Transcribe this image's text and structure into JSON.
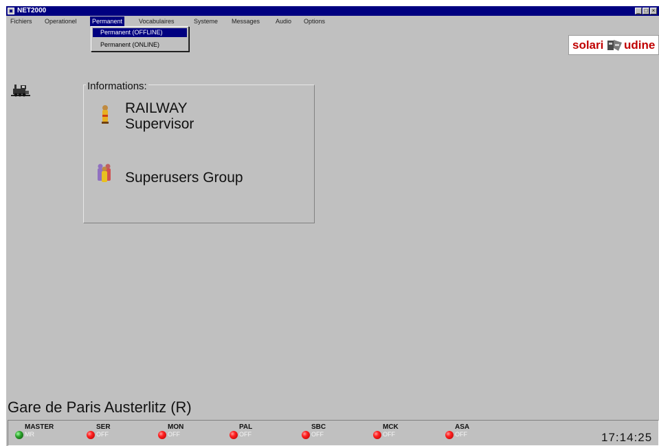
{
  "window": {
    "title": "NET2000"
  },
  "menubar": {
    "items": [
      {
        "label": "Fichiers"
      },
      {
        "label": "Operationel"
      },
      {
        "label": "Permanent"
      },
      {
        "label": "Vocabulaires"
      },
      {
        "label": "Systeme"
      },
      {
        "label": "Messages"
      },
      {
        "label": "Audio"
      },
      {
        "label": "Options"
      }
    ],
    "open_menu": {
      "items": [
        {
          "label": "Permanent (OFFLINE)",
          "selected": true
        },
        {
          "label": "Permanent (ONLINE)",
          "selected": false
        }
      ]
    }
  },
  "logo": {
    "left": "solari",
    "right": "udine",
    "color": "#c00000"
  },
  "info": {
    "legend": "Informations:",
    "user_line1": "RAILWAY",
    "user_line2": "Supervisor",
    "group": "Superusers Group"
  },
  "station": {
    "name": "Gare de Paris Austerlitz (R)"
  },
  "status": {
    "services": [
      {
        "name": "MASTER",
        "state": "MR",
        "led": "green"
      },
      {
        "name": "SER",
        "state": "OFF",
        "led": "red"
      },
      {
        "name": "MON",
        "state": "OFF",
        "led": "red"
      },
      {
        "name": "PAL",
        "state": "OFF",
        "led": "red"
      },
      {
        "name": "SBC",
        "state": "OFF",
        "led": "red"
      },
      {
        "name": "MCK",
        "state": "OFF",
        "led": "red"
      },
      {
        "name": "ASA",
        "state": "OFF",
        "led": "red"
      }
    ],
    "clock": "17:14:25"
  },
  "icons": [
    "app-icon",
    "train-icon",
    "user-icon",
    "group-icon",
    "solari-logo-mark",
    "led-green",
    "led-red"
  ]
}
